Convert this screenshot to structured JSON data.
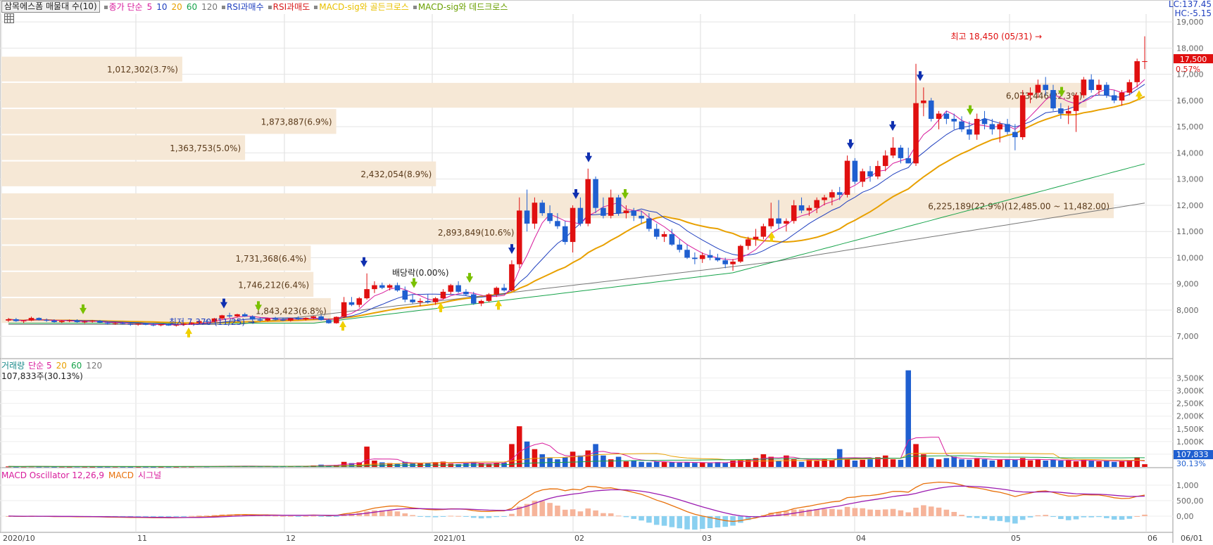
{
  "header": {
    "selector_label": "삼목에스폼 매물대 수(10)",
    "legend_items": [
      {
        "label": "종가 단순",
        "color": "#d81b9c"
      },
      {
        "label": "5",
        "color": "#d81b9c"
      },
      {
        "label": "10",
        "color": "#1f3fbf"
      },
      {
        "label": "20",
        "color": "#e8a000"
      },
      {
        "label": "60",
        "color": "#16a34a"
      },
      {
        "label": "120",
        "color": "#777777"
      },
      {
        "label": "RSI과매수",
        "color": "#1f3fbf"
      },
      {
        "label": "RSI과매도",
        "color": "#d81b1b"
      },
      {
        "label": "MACD-sig와 골든크로스",
        "color": "#e8c000"
      },
      {
        "label": "MACD-sig와 데드크로스",
        "color": "#6aa000"
      }
    ],
    "lc": "LC:137.45",
    "hc": "HC:-5.15"
  },
  "volume_legend": {
    "title": "거래량",
    "items": [
      {
        "label": "단순 5",
        "color": "#d81b9c"
      },
      {
        "label": "20",
        "color": "#e8a000"
      },
      {
        "label": "60",
        "color": "#16a34a"
      },
      {
        "label": "120",
        "color": "#777777"
      }
    ],
    "current": "107,833주(30.13%)"
  },
  "macd_legend": {
    "items": [
      {
        "label": "MACD Oscillator 12,26,9",
        "color": "#d81b9c"
      },
      {
        "label": "MACD",
        "color": "#e8700a"
      },
      {
        "label": "시그널",
        "color": "#d81b9c"
      }
    ]
  },
  "colors": {
    "up": "#e01010",
    "down": "#1f5fd0",
    "profile": "#f6e8d6",
    "ma5": "#d81b9c",
    "ma10": "#1f3fbf",
    "ma20": "#e8a000",
    "ma60": "#16a34a",
    "ma120": "#777777",
    "macd": "#e8700a",
    "signal": "#9b1bb0",
    "osc_pos": "#f6b49a",
    "osc_neg": "#8ad0f0"
  },
  "chart_data": [
    {
      "type": "candlestick",
      "title": "삼목에스폼",
      "y_ticks": [
        "19,000",
        "18,000",
        "17,000",
        "16,000",
        "15,000",
        "14,000",
        "13,000",
        "12,000",
        "11,000",
        "10,000",
        "9,000",
        "8,000",
        "7,000"
      ],
      "ylim": [
        6200,
        19300
      ],
      "x_ticks": [
        "2020/10",
        "11",
        "12",
        "2021/01",
        "02",
        "03",
        "04",
        "05",
        "06",
        "06/01"
      ],
      "candles": [
        [
          7600,
          7700,
          7550,
          7650
        ],
        [
          7650,
          7700,
          7550,
          7580
        ],
        [
          7580,
          7620,
          7500,
          7600
        ],
        [
          7600,
          7750,
          7580,
          7700
        ],
        [
          7700,
          7720,
          7600,
          7620
        ],
        [
          7620,
          7680,
          7550,
          7600
        ],
        [
          7600,
          7650,
          7520,
          7540
        ],
        [
          7540,
          7620,
          7500,
          7580
        ],
        [
          7580,
          7640,
          7540,
          7610
        ],
        [
          7610,
          7650,
          7520,
          7540
        ],
        [
          7540,
          7600,
          7480,
          7560
        ],
        [
          7560,
          7620,
          7520,
          7590
        ],
        [
          7590,
          7620,
          7500,
          7520
        ],
        [
          7520,
          7560,
          7450,
          7480
        ],
        [
          7480,
          7540,
          7440,
          7500
        ],
        [
          7500,
          7560,
          7460,
          7470
        ],
        [
          7470,
          7520,
          7400,
          7450
        ],
        [
          7450,
          7500,
          7400,
          7480
        ],
        [
          7480,
          7520,
          7420,
          7440
        ],
        [
          7440,
          7480,
          7380,
          7420
        ],
        [
          7420,
          7470,
          7380,
          7460
        ],
        [
          7460,
          7500,
          7400,
          7410
        ],
        [
          7410,
          7450,
          7370,
          7440
        ],
        [
          7440,
          7500,
          7400,
          7480
        ],
        [
          7480,
          7540,
          7440,
          7520
        ],
        [
          7520,
          7600,
          7480,
          7580
        ],
        [
          7580,
          7640,
          7540,
          7560
        ],
        [
          7560,
          7700,
          7540,
          7680
        ],
        [
          7680,
          7820,
          7640,
          7800
        ],
        [
          7800,
          7900,
          7700,
          7760
        ],
        [
          7760,
          7860,
          7720,
          7840
        ],
        [
          7840,
          7900,
          7740,
          7760
        ],
        [
          7760,
          7800,
          7600,
          7640
        ],
        [
          7640,
          7720,
          7560,
          7600
        ],
        [
          7600,
          7700,
          7560,
          7680
        ],
        [
          7680,
          7740,
          7600,
          7640
        ],
        [
          7640,
          7700,
          7580,
          7600
        ],
        [
          7600,
          7700,
          7560,
          7690
        ],
        [
          7690,
          7760,
          7620,
          7650
        ],
        [
          7650,
          7720,
          7600,
          7700
        ],
        [
          7700,
          7780,
          7640,
          7760
        ],
        [
          7760,
          7820,
          7600,
          7620
        ],
        [
          7620,
          7680,
          7480,
          7500
        ],
        [
          7500,
          7760,
          7480,
          7740
        ],
        [
          7740,
          8500,
          7700,
          8300
        ],
        [
          8300,
          8500,
          8150,
          8200
        ],
        [
          8200,
          8500,
          8100,
          8450
        ],
        [
          8450,
          9400,
          8400,
          8800
        ],
        [
          8800,
          9100,
          8650,
          8950
        ],
        [
          8950,
          9050,
          8800,
          8850
        ],
        [
          8850,
          9000,
          8750,
          8950
        ],
        [
          8950,
          9050,
          8700,
          8750
        ],
        [
          8750,
          8900,
          8300,
          8400
        ],
        [
          8400,
          8600,
          8250,
          8300
        ],
        [
          8300,
          8450,
          8150,
          8350
        ],
        [
          8350,
          8600,
          8250,
          8300
        ],
        [
          8300,
          8500,
          8200,
          8450
        ],
        [
          8450,
          8800,
          8400,
          8700
        ],
        [
          8700,
          9000,
          8600,
          8950
        ],
        [
          8950,
          9100,
          8650,
          8700
        ],
        [
          8700,
          8800,
          8550,
          8600
        ],
        [
          8600,
          8700,
          8200,
          8250
        ],
        [
          8250,
          8400,
          8150,
          8350
        ],
        [
          8350,
          8650,
          8300,
          8600
        ],
        [
          8600,
          8900,
          8500,
          8850
        ],
        [
          8850,
          9000,
          8700,
          8750
        ],
        [
          8750,
          9900,
          8700,
          9750
        ],
        [
          9750,
          12300,
          9600,
          11800
        ],
        [
          11800,
          12600,
          11000,
          11300
        ],
        [
          11300,
          12300,
          11100,
          12100
        ],
        [
          12100,
          12200,
          11600,
          11700
        ],
        [
          11700,
          12000,
          11300,
          11400
        ],
        [
          11400,
          11700,
          11100,
          11200
        ],
        [
          11200,
          11400,
          10500,
          10600
        ],
        [
          10600,
          12000,
          10200,
          11900
        ],
        [
          11900,
          12300,
          11200,
          11300
        ],
        [
          11300,
          13400,
          11200,
          13000
        ],
        [
          13000,
          13100,
          11700,
          11900
        ],
        [
          11900,
          12300,
          11500,
          11600
        ],
        [
          11600,
          12600,
          11500,
          12300
        ],
        [
          12300,
          12400,
          11600,
          11700
        ],
        [
          11700,
          12000,
          11500,
          11800
        ],
        [
          11800,
          11900,
          11400,
          11600
        ],
        [
          11600,
          11800,
          11300,
          11500
        ],
        [
          11500,
          11700,
          11000,
          11100
        ],
        [
          11100,
          11300,
          10700,
          10800
        ],
        [
          10800,
          11000,
          10600,
          10900
        ],
        [
          10900,
          11100,
          10450,
          10500
        ],
        [
          10500,
          10700,
          10200,
          10300
        ],
        [
          10300,
          10500,
          9950,
          10000
        ],
        [
          10000,
          10200,
          9750,
          9950
        ],
        [
          9950,
          10200,
          9800,
          10100
        ],
        [
          10100,
          10300,
          9900,
          10000
        ],
        [
          10000,
          10150,
          9850,
          9900
        ],
        [
          9900,
          10000,
          9600,
          9750
        ],
        [
          9750,
          9950,
          9500,
          9850
        ],
        [
          9850,
          10500,
          9800,
          10450
        ],
        [
          10450,
          10800,
          10300,
          10700
        ],
        [
          10700,
          11100,
          10450,
          10800
        ],
        [
          10800,
          11300,
          10700,
          11200
        ],
        [
          11200,
          12100,
          11100,
          11500
        ],
        [
          11500,
          12200,
          11100,
          11300
        ],
        [
          11300,
          11500,
          11000,
          11400
        ],
        [
          11400,
          12200,
          11300,
          12000
        ],
        [
          12000,
          12300,
          11700,
          11800
        ],
        [
          11800,
          12000,
          11600,
          11900
        ],
        [
          11900,
          12300,
          11700,
          12200
        ],
        [
          12200,
          12400,
          12000,
          12300
        ],
        [
          12300,
          12600,
          12000,
          12500
        ],
        [
          12500,
          12700,
          12200,
          12400
        ],
        [
          12400,
          13900,
          12300,
          13700
        ],
        [
          13700,
          13800,
          12800,
          12900
        ],
        [
          12900,
          13400,
          12700,
          13300
        ],
        [
          13300,
          13500,
          12900,
          13100
        ],
        [
          13100,
          13700,
          13000,
          13500
        ],
        [
          13500,
          14100,
          13300,
          13900
        ],
        [
          13900,
          14600,
          13800,
          14200
        ],
        [
          14200,
          14300,
          13600,
          13800
        ],
        [
          13800,
          14200,
          13600,
          13600
        ],
        [
          13600,
          17400,
          13500,
          15900
        ],
        [
          15900,
          16500,
          15400,
          16000
        ],
        [
          16000,
          16100,
          15200,
          15300
        ],
        [
          15300,
          15600,
          14900,
          15500
        ],
        [
          15500,
          15600,
          15100,
          15300
        ],
        [
          15300,
          15500,
          14900,
          15200
        ],
        [
          15200,
          15400,
          14800,
          14900
        ],
        [
          14900,
          15200,
          14500,
          14700
        ],
        [
          14700,
          15500,
          14500,
          15300
        ],
        [
          15300,
          15600,
          14900,
          15100
        ],
        [
          15100,
          15300,
          14700,
          14900
        ],
        [
          14900,
          15200,
          14400,
          15100
        ],
        [
          15100,
          15300,
          14700,
          14800
        ],
        [
          14800,
          15100,
          14100,
          14600
        ],
        [
          14600,
          16400,
          14500,
          16200
        ],
        [
          16200,
          16500,
          15900,
          16300
        ],
        [
          16300,
          16800,
          16100,
          16600
        ],
        [
          16600,
          16900,
          16200,
          16400
        ],
        [
          16400,
          16600,
          15600,
          15700
        ],
        [
          15700,
          15900,
          15300,
          15500
        ],
        [
          15500,
          15800,
          15100,
          15600
        ],
        [
          15600,
          16300,
          14800,
          16200
        ],
        [
          16200,
          16900,
          16100,
          16800
        ],
        [
          16800,
          17000,
          16300,
          16400
        ],
        [
          16400,
          16800,
          16200,
          16600
        ],
        [
          16600,
          16700,
          16100,
          16200
        ],
        [
          16200,
          16400,
          15900,
          16000
        ],
        [
          16000,
          16400,
          15800,
          16300
        ],
        [
          16300,
          16800,
          16200,
          16700
        ],
        [
          16700,
          17600,
          16500,
          17500
        ],
        [
          17500,
          18450,
          17200,
          17500
        ]
      ],
      "volume_profile": [
        {
          "label": "1,012,302(3.7%)",
          "high": 17700,
          "low": 16700,
          "value": 1012302
        },
        {
          "label": "6,073,446(22.3%)",
          "high": 16700,
          "low": 15700,
          "value": 6073446
        },
        {
          "label": "1,873,887(6.9%)",
          "high": 15700,
          "low": 14700,
          "value": 1873887
        },
        {
          "label": "1,363,753(5.0%)",
          "high": 14700,
          "low": 13700,
          "value": 1363753
        },
        {
          "label": "2,432,054(8.9%)",
          "high": 13700,
          "low": 12700,
          "value": 2432054
        },
        {
          "label": "6,225,189(22.9%)(12,485.00 ~ 11,482.00)",
          "high": 12485,
          "low": 11482,
          "value": 6225189
        },
        {
          "label": "2,893,849(10.6%)",
          "high": 11482,
          "low": 10482,
          "value": 2893849
        },
        {
          "label": "1,731,368(6.4%)",
          "high": 10482,
          "low": 9482,
          "value": 1731368
        },
        {
          "label": "1,746,212(6.4%)",
          "high": 9482,
          "low": 8482,
          "value": 1746212
        },
        {
          "label": "1,843,423(6.8%)",
          "high": 8482,
          "low": 7482,
          "value": 1843423
        }
      ],
      "annotations": {
        "high_label": "최고 18,450 (05/31) →",
        "low_label": "최저 7,370 (11/25) →",
        "dividend_label": "배당락(0.00%)",
        "price_tag": "17,500",
        "change_tag": "0.57%"
      }
    },
    {
      "type": "bar",
      "title": "거래량",
      "y_ticks": [
        "3,500K",
        "3,000K",
        "2,500K",
        "2,000K",
        "1,500K",
        "1,000K",
        "500K"
      ],
      "ylim": [
        0,
        3900
      ],
      "values": [
        20,
        15,
        18,
        22,
        16,
        18,
        14,
        17,
        15,
        19,
        16,
        14,
        13,
        15,
        17,
        16,
        12,
        14,
        15,
        13,
        14,
        16,
        15,
        20,
        18,
        25,
        22,
        30,
        40,
        35,
        28,
        30,
        35,
        26,
        30,
        24,
        25,
        40,
        30,
        35,
        60,
        90,
        70,
        80,
        200,
        150,
        180,
        800,
        250,
        180,
        150,
        120,
        200,
        160,
        140,
        150,
        190,
        210,
        130,
        110,
        140,
        200,
        150,
        120,
        160,
        170,
        900,
        1600,
        1000,
        700,
        500,
        350,
        300,
        380,
        600,
        450,
        650,
        900,
        450,
        300,
        400,
        220,
        260,
        200,
        180,
        210,
        190,
        180,
        170,
        180,
        160,
        170,
        150,
        190,
        160,
        250,
        280,
        300,
        350,
        500,
        400,
        250,
        450,
        300,
        200,
        280,
        240,
        300,
        260,
        700,
        300,
        250,
        280,
        300,
        380,
        450,
        300,
        280,
        3800,
        900,
        500,
        350,
        300,
        350,
        400,
        300,
        280,
        350,
        300,
        250,
        280,
        300,
        280,
        350,
        260,
        300,
        250,
        280,
        250,
        260,
        220,
        280,
        250,
        220,
        240,
        200,
        230,
        260,
        380,
        108
      ],
      "price_tags": [
        "107,833",
        "30.13%"
      ]
    },
    {
      "type": "line",
      "title": "MACD",
      "y_ticks": [
        "1,000",
        "500,00",
        "0,00"
      ],
      "ylim": [
        -500,
        1200
      ],
      "x_ticks": [
        "2020/10",
        "11",
        "12",
        "2021/01",
        "02",
        "03",
        "04",
        "05",
        "06",
        "06/01"
      ]
    }
  ]
}
